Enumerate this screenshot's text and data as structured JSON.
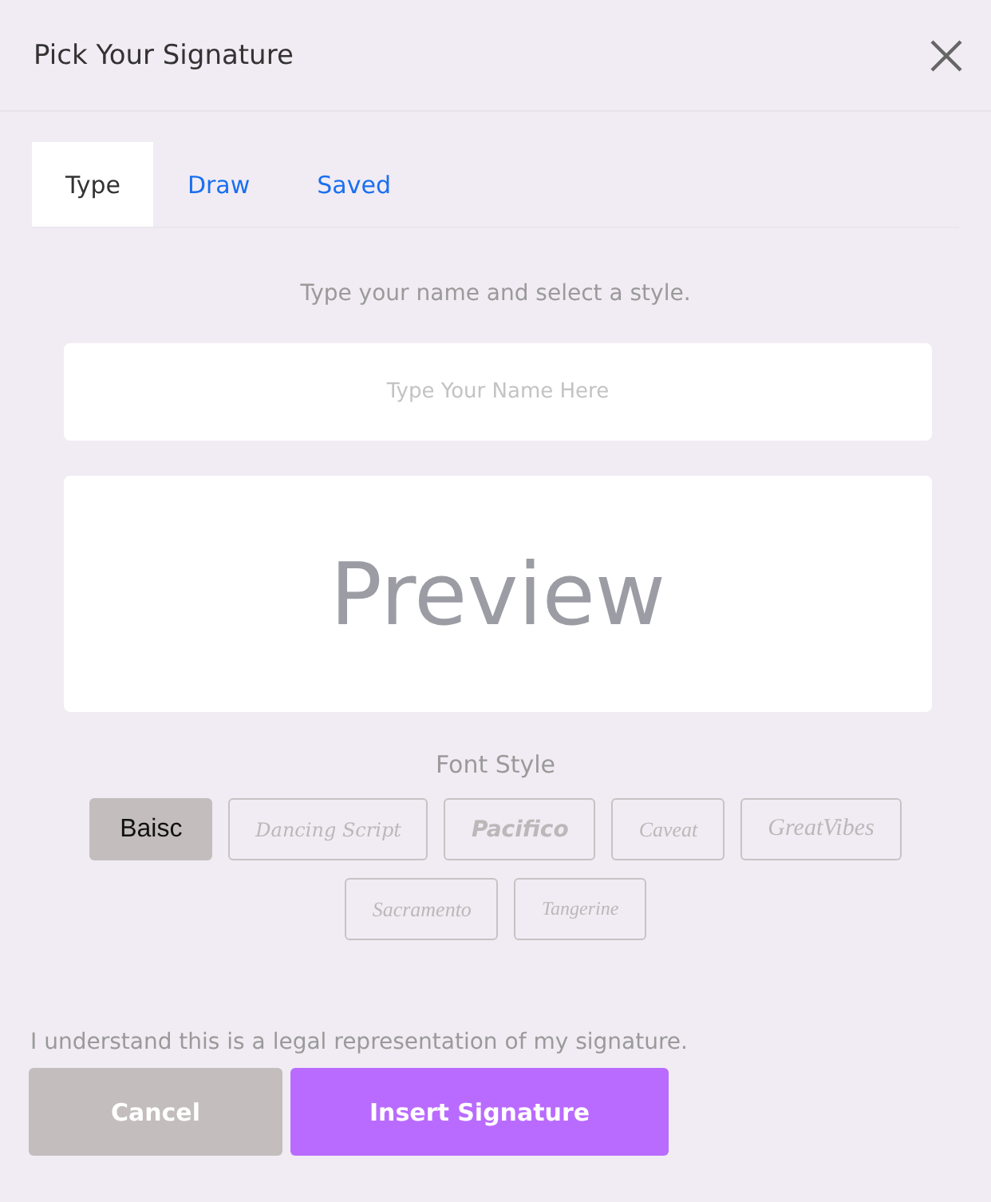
{
  "dialog": {
    "title": "Pick Your Signature"
  },
  "tabs": [
    {
      "label": "Type",
      "selected": true
    },
    {
      "label": "Draw",
      "selected": false
    },
    {
      "label": "Saved",
      "selected": false
    }
  ],
  "instruction": "Type your name and select a style.",
  "name_field": {
    "placeholder": "Type Your Name Here"
  },
  "preview": "Preview",
  "font_style_label": "Font Style",
  "font_styles": [
    {
      "label": "Baisc",
      "selected": true
    },
    {
      "label": "Dancing Script",
      "selected": false
    },
    {
      "label": "Pacifico",
      "selected": false
    },
    {
      "label": "Caveat",
      "selected": false
    },
    {
      "label": "GreatVibes",
      "selected": false
    },
    {
      "label": "Sacramento",
      "selected": false
    },
    {
      "label": "Tangerine",
      "selected": false
    }
  ],
  "legal_note": "I understand this is a legal representation of my signature.",
  "buttons": [
    {
      "label": "Cancel",
      "kind": "secondary"
    },
    {
      "label": "Insert Signature",
      "kind": "primary"
    }
  ]
}
